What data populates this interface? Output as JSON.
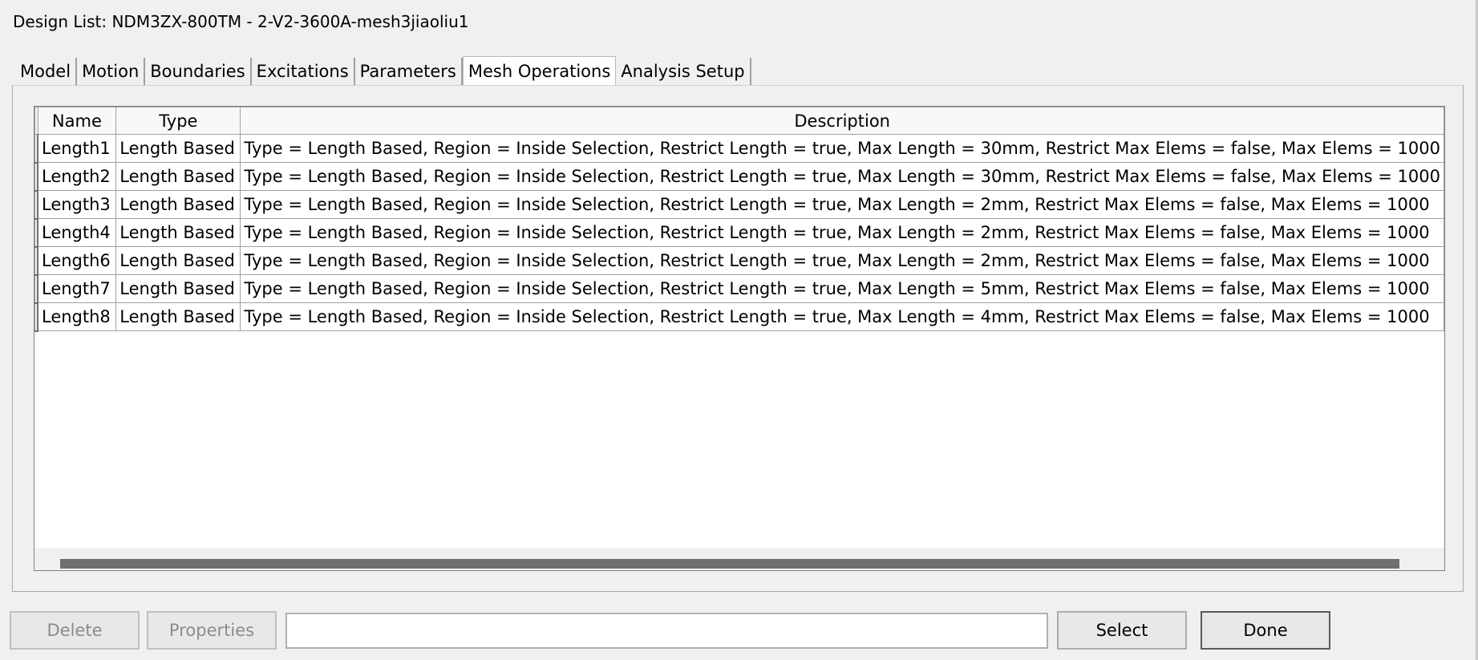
{
  "window": {
    "title": "Design List: NDM3ZX-800TM - 2-V2-3600A-mesh3jiaoliu1"
  },
  "tabs": [
    {
      "label": "Model",
      "active": false
    },
    {
      "label": "Motion",
      "active": false
    },
    {
      "label": "Boundaries",
      "active": false
    },
    {
      "label": "Excitations",
      "active": false
    },
    {
      "label": "Parameters",
      "active": false
    },
    {
      "label": "Mesh Operations",
      "active": true
    },
    {
      "label": "Analysis Setup",
      "active": false
    }
  ],
  "grid": {
    "columns": [
      "Name",
      "Type",
      "Description"
    ],
    "rows": [
      {
        "name": "Length1",
        "type": "Length Based",
        "description": "Type = Length Based, Region = Inside Selection, Restrict Length = true, Max Length = 30mm, Restrict Max Elems = false, Max Elems = 1000"
      },
      {
        "name": "Length2",
        "type": "Length Based",
        "description": "Type = Length Based, Region = Inside Selection, Restrict Length = true, Max Length = 30mm, Restrict Max Elems = false, Max Elems = 1000"
      },
      {
        "name": "Length3",
        "type": "Length Based",
        "description": "Type = Length Based, Region = Inside Selection, Restrict Length = true, Max Length = 2mm, Restrict Max Elems = false, Max Elems = 1000"
      },
      {
        "name": "Length4",
        "type": "Length Based",
        "description": "Type = Length Based, Region = Inside Selection, Restrict Length = true, Max Length = 2mm, Restrict Max Elems = false, Max Elems = 1000"
      },
      {
        "name": "Length6",
        "type": "Length Based",
        "description": "Type = Length Based, Region = Inside Selection, Restrict Length = true, Max Length = 2mm, Restrict Max Elems = false, Max Elems = 1000"
      },
      {
        "name": "Length7",
        "type": "Length Based",
        "description": "Type = Length Based, Region = Inside Selection, Restrict Length = true, Max Length = 5mm, Restrict Max Elems = false, Max Elems = 1000"
      },
      {
        "name": "Length8",
        "type": "Length Based",
        "description": "Type = Length Based, Region = Inside Selection, Restrict Length = true, Max Length = 4mm, Restrict Max Elems = false, Max Elems = 1000"
      }
    ]
  },
  "buttons": {
    "delete_label": "Delete",
    "properties_label": "Properties",
    "select_label": "Select",
    "done_label": "Done"
  },
  "filter": {
    "value": ""
  }
}
